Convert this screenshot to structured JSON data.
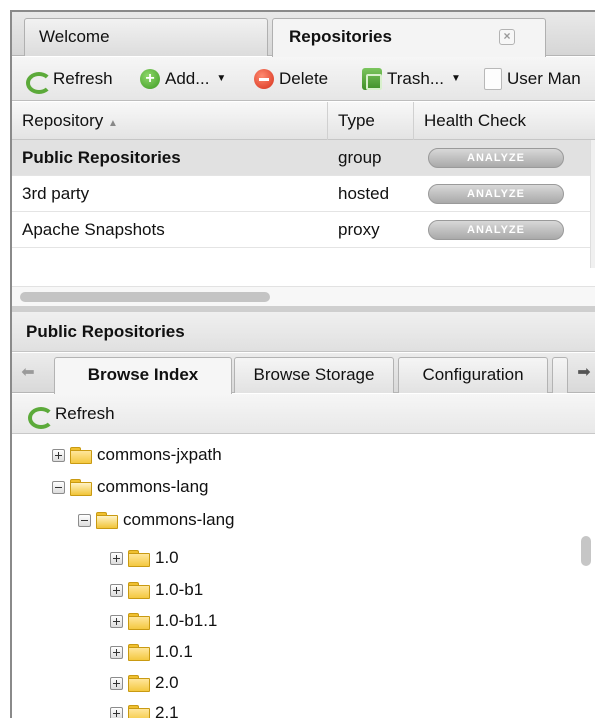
{
  "tabs": [
    {
      "label": "Welcome"
    },
    {
      "label": "Repositories"
    }
  ],
  "toolbar": {
    "refresh": "Refresh",
    "add": "Add...",
    "delete": "Delete",
    "trash": "Trash...",
    "user_man": "User Man"
  },
  "grid": {
    "columns": [
      "Repository",
      "Type",
      "Health Check"
    ],
    "sort_indicator": "▲",
    "rows": [
      {
        "name": "Public Repositories",
        "type": "group",
        "action": "ANALYZE"
      },
      {
        "name": "3rd party",
        "type": "hosted",
        "action": "ANALYZE"
      },
      {
        "name": "Apache Snapshots",
        "type": "proxy",
        "action": "ANALYZE"
      }
    ]
  },
  "panel": {
    "title": "Public Repositories",
    "subtabs": [
      "Browse Index",
      "Browse Storage",
      "Configuration"
    ],
    "refresh": "Refresh"
  },
  "tree": [
    {
      "label": "commons-jxpath",
      "expanded": false,
      "level": 0
    },
    {
      "label": "commons-lang",
      "expanded": true,
      "level": 0
    },
    {
      "label": "commons-lang",
      "expanded": true,
      "level": 1
    },
    {
      "label": "1.0",
      "expanded": false,
      "level": 2
    },
    {
      "label": "1.0-b1",
      "expanded": false,
      "level": 2
    },
    {
      "label": "1.0-b1.1",
      "expanded": false,
      "level": 2
    },
    {
      "label": "1.0.1",
      "expanded": false,
      "level": 2
    },
    {
      "label": "2.0",
      "expanded": false,
      "level": 2
    },
    {
      "label": "2.1",
      "expanded": false,
      "level": 2
    }
  ]
}
